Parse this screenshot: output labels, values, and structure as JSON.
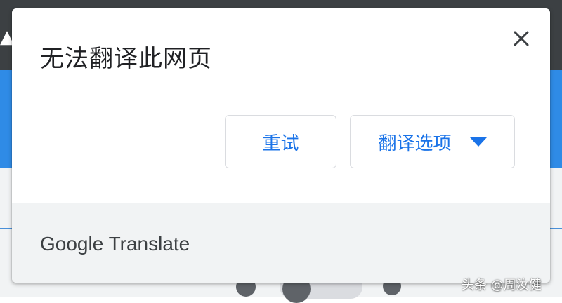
{
  "dialog": {
    "title": "无法翻译此网页",
    "close_icon": "close-icon",
    "buttons": {
      "retry_label": "重试",
      "options_label": "翻译选项",
      "options_icon": "caret-down-icon"
    },
    "footer": {
      "brand": "Google Translate"
    }
  },
  "watermark": "头条 @周汝健",
  "colors": {
    "accent": "#1a73e8",
    "footer_bg": "#f1f3f4",
    "page_blue": "#2f8be6",
    "page_dark": "#3c4043"
  }
}
